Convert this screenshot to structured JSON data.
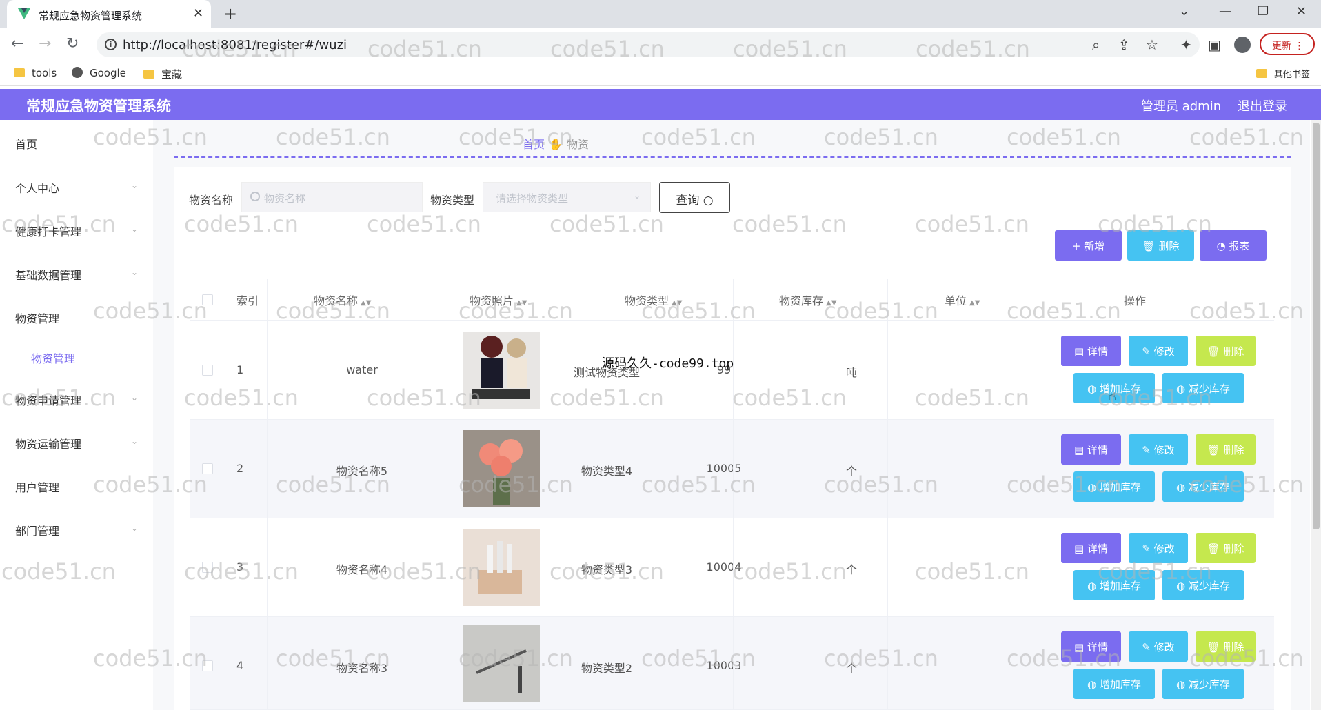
{
  "browser": {
    "tab_title": "常规应急物资管理系统",
    "url": "http://localhost:8081/register#/wuzi",
    "update_label": "更新",
    "bookmarks": [
      "tools",
      "Google",
      "宝藏"
    ],
    "other_bookmarks": "其他书签"
  },
  "header": {
    "title": "常规应急物资管理系统",
    "user": "管理员 admin",
    "logout": "退出登录"
  },
  "sidebar": {
    "items": [
      "首页",
      "个人中心",
      "健康打卡管理",
      "基础数据管理",
      "物资管理",
      "物资申请管理",
      "物资运输管理",
      "用户管理",
      "部门管理"
    ],
    "active_sub": "物资管理"
  },
  "breadcrumb": {
    "home": "首页",
    "current": "物资"
  },
  "search": {
    "name_label": "物资名称",
    "name_placeholder": "物资名称",
    "type_label": "物资类型",
    "type_placeholder": "请选择物资类型",
    "query_label": "查询"
  },
  "toolbar": {
    "add": "新增",
    "delete": "删除",
    "report": "报表"
  },
  "table": {
    "columns": [
      "索引",
      "物资名称",
      "物资照片",
      "物资类型",
      "物资库存",
      "单位",
      "操作"
    ],
    "rows": [
      {
        "index": "1",
        "name": "water",
        "type": "测试物资类型",
        "stock": "99",
        "unit": "吨"
      },
      {
        "index": "2",
        "name": "物资名称5",
        "type": "物资类型4",
        "stock": "10005",
        "unit": "个"
      },
      {
        "index": "3",
        "name": "物资名称4",
        "type": "物资类型3",
        "stock": "10004",
        "unit": "个"
      },
      {
        "index": "4",
        "name": "物资名称3",
        "type": "物资类型2",
        "stock": "10003",
        "unit": "个"
      }
    ],
    "actions": {
      "detail": "详情",
      "edit": "修改",
      "delete": "删除",
      "add_stock": "增加库存",
      "reduce_stock": "减少库存"
    }
  },
  "overlay_text": "源码久久-code99.top",
  "watermark": "code51.cn",
  "colors": {
    "primary": "#7b6cf0",
    "info": "#45c3f2",
    "warning": "#c5e84e"
  }
}
